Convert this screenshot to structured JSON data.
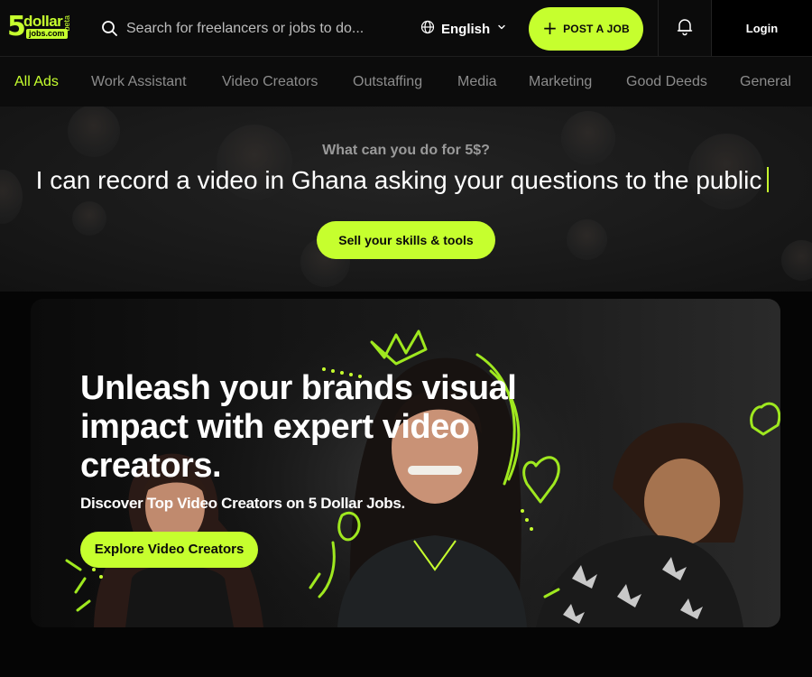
{
  "header": {
    "logo": {
      "five": "5",
      "word": "dollar",
      "sub": "jobs.com",
      "beta": "beta"
    },
    "search": {
      "placeholder": "Search for freelancers or jobs to do..."
    },
    "language": "English",
    "post_job_label": "POST A JOB",
    "login_label": "Login"
  },
  "categories": [
    {
      "label": "All Ads",
      "active": true
    },
    {
      "label": "Work Assistant"
    },
    {
      "label": "Video Creators"
    },
    {
      "label": "Outstaffing"
    },
    {
      "label": "Media"
    },
    {
      "label": "Marketing"
    },
    {
      "label": "Good Deeds"
    },
    {
      "label": "General"
    }
  ],
  "hero": {
    "question": "What can you do for 5$?",
    "typed_text": "I can record a video in Ghana asking your questions to the public",
    "sell_button": "Sell your skills & tools"
  },
  "banner": {
    "headline": "Unleash your brands visual impact with expert video creators.",
    "subtitle": "Discover Top Video Creators on 5 Dollar Jobs.",
    "explore_button": "Explore Video Creators"
  },
  "colors": {
    "accent": "#c6ff2e",
    "background": "#050505",
    "nav_text": "#8c8c8c"
  },
  "icons": {
    "search": "search-icon",
    "language": "globe-icon",
    "chevron": "chevron-down-icon",
    "plus": "plus-icon",
    "notifications": "bell-icon"
  }
}
